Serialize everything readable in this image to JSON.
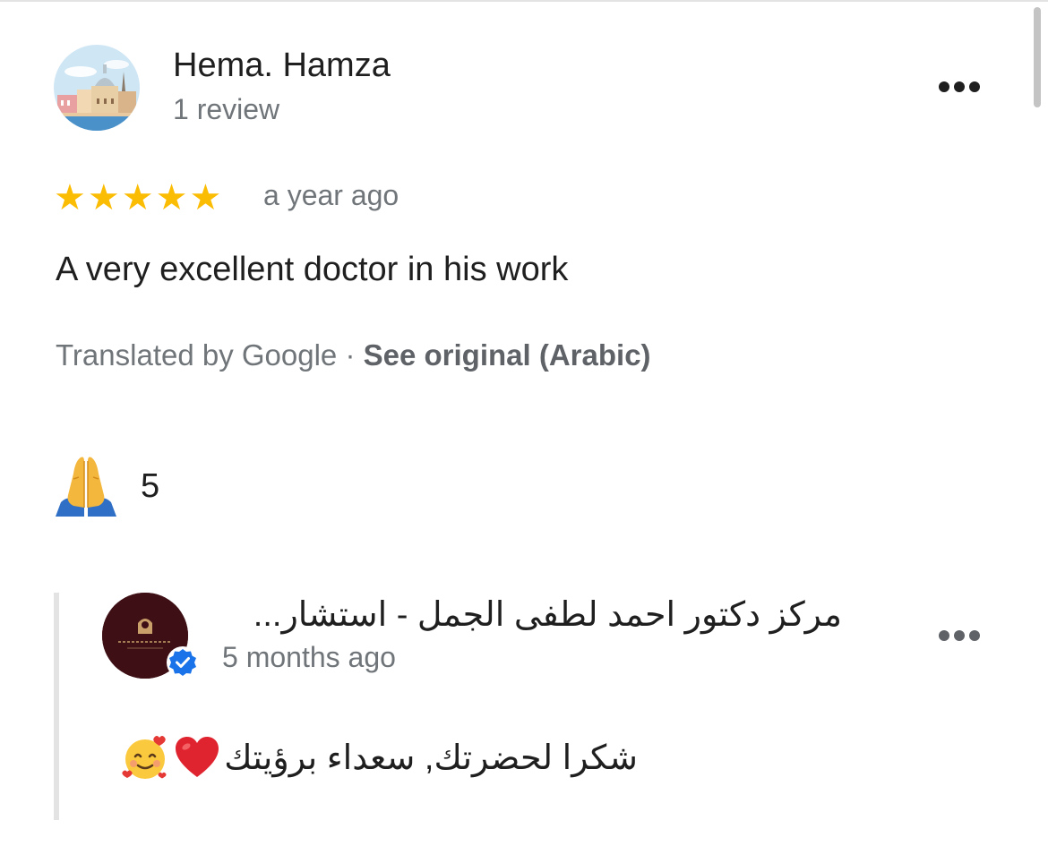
{
  "review": {
    "reviewer_name": "Hema. Hamza",
    "review_count": "1 review",
    "rating": 5,
    "max_rating": 5,
    "time_ago": "a year ago",
    "text": "A very excellent doctor in his work",
    "translated_by": "Translated by Google · ",
    "see_original": "See original (Arabic)",
    "reaction_icon": "folded-hands-icon",
    "reaction_count": "5"
  },
  "owner_reply": {
    "name": "مركز دكتور احمد لطفى الجمل - استشار...",
    "time_ago": "5 months ago",
    "text": "شكرا لحضرتك, سعداء برؤيتك",
    "verified": true
  },
  "colors": {
    "star": "#fbbc04",
    "secondary_text": "#70757a",
    "verified_badge": "#1a73e8",
    "owner_avatar_bg": "#3e1016"
  }
}
